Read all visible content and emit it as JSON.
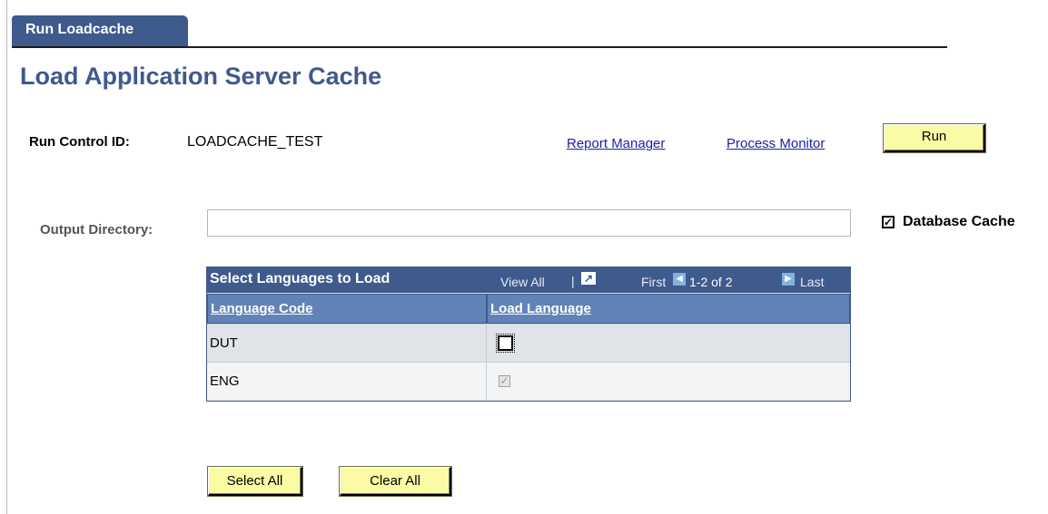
{
  "tab": {
    "label": "Run Loadcache"
  },
  "page_title": "Load Application Server Cache",
  "run_control": {
    "label": "Run Control ID:",
    "value": "LOADCACHE_TEST"
  },
  "links": {
    "report_manager": "Report Manager",
    "process_monitor": "Process Monitor"
  },
  "buttons": {
    "run": "Run",
    "select_all": "Select All",
    "clear_all": "Clear All"
  },
  "output_directory": {
    "label": "Output Directory:",
    "value": ""
  },
  "database_cache": {
    "label": "Database Cache",
    "checked": true,
    "mark": "✓"
  },
  "grid": {
    "title": "Select Languages to Load",
    "view_all": "View All",
    "separator": "|",
    "first": "First",
    "range": "1-2 of 2",
    "last": "Last",
    "columns": [
      "Language Code",
      "Load Language"
    ],
    "rows": [
      {
        "code": "DUT",
        "load": false,
        "mark": ""
      },
      {
        "code": "ENG",
        "load": true,
        "mark": "✓"
      }
    ]
  },
  "colors": {
    "header_blue": "#3f5a8c",
    "column_blue": "#6283b7",
    "button_yellow": "#fbfba6",
    "link_blue": "#1d1da3"
  }
}
